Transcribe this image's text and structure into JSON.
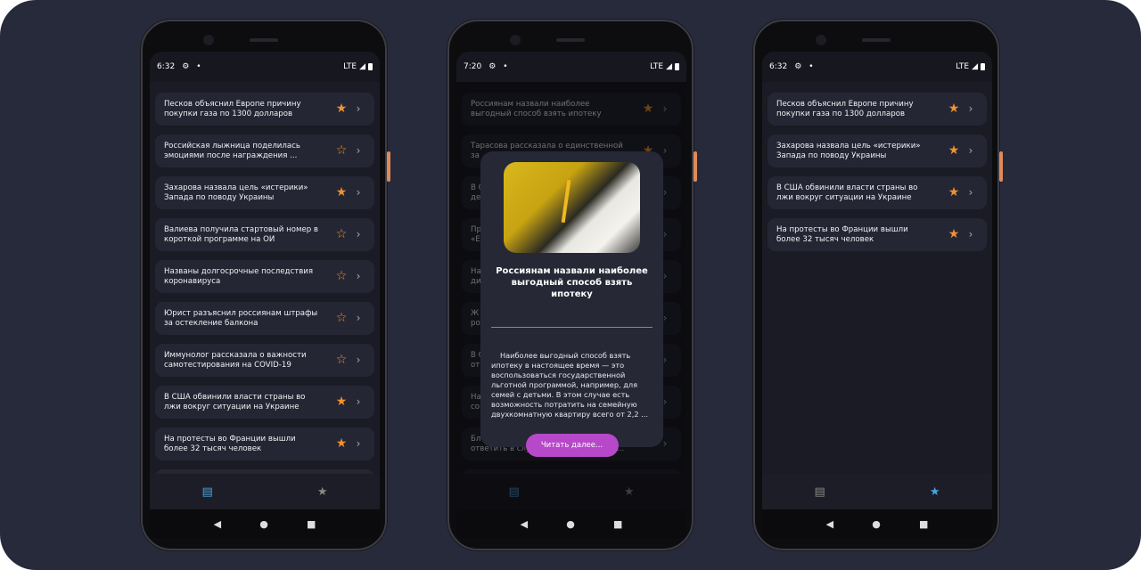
{
  "phones": [
    {
      "time": "6:32",
      "network": "LTE",
      "items": [
        {
          "title": "Песков объяснил Европе причину\nпокупки газа по 1300 долларов",
          "fav": true
        },
        {
          "title": "Российская лыжница поделилась\nэмоциями после награждения ...",
          "fav": false
        },
        {
          "title": "Захарова назвала цель «истерики»\nЗапада по поводу Украины",
          "fav": true
        },
        {
          "title": "Валиева получила стартовый номер в\nкороткой программе на ОИ",
          "fav": false
        },
        {
          "title": "Названы долгосрочные последствия\nкоронавируса",
          "fav": false
        },
        {
          "title": "Юрист разъяснил россиянам штрафы\nза остекление балкона",
          "fav": false
        },
        {
          "title": "Иммунолог рассказала о важности\nсамотестирования на COVID-19",
          "fav": false
        },
        {
          "title": "В США обвинили власти страны во\nлжи вокруг ситуации на Украине",
          "fav": true
        },
        {
          "title": "На протесты во Франции вышли\nболее 32 тысяч человек",
          "fav": true
        },
        {
          "title": "",
          "fav": false
        }
      ],
      "active_tab": "news"
    },
    {
      "time": "7:20",
      "network": "LTE",
      "items": [
        {
          "title": "Россиянам назвали наиболее\nвыгодный способ взять ипотеку",
          "fav": true
        },
        {
          "title": "Тарасова рассказала о единственной\nза",
          "fav": true
        },
        {
          "title": "В С\nде",
          "fav": false
        },
        {
          "title": "Пр\n«Е",
          "fav": false
        },
        {
          "title": "На\nди",
          "fav": false
        },
        {
          "title": "Ж\nро",
          "fav": false
        },
        {
          "title": "В С\nот",
          "fav": false
        },
        {
          "title": "На\nсо",
          "fav": false
        },
        {
          "title": "Бл\nответить в случае агрессии против ...",
          "fav": true
        },
        {
          "title": "",
          "fav": false
        }
      ],
      "active_tab": "news",
      "modal": {
        "title": "Россиянам назвали наиболее выгодный способ взять ипотеку",
        "body": "Наиболее выгодный способ взять ипотеку в настоящее время — это воспользоваться государственной льготной программой, например, для семей с детьми. В этом случае есть возможность потратить на семейную двухкомнатную квартиру всего от 2,2 ...",
        "button": "Читать далее..."
      }
    },
    {
      "time": "6:32",
      "network": "LTE",
      "items": [
        {
          "title": "Песков объяснил Европе причину\nпокупки газа по 1300 долларов",
          "fav": true
        },
        {
          "title": "Захарова назвала цель «истерики»\nЗапада по поводу Украины",
          "fav": true
        },
        {
          "title": "В США обвинили власти страны во\nлжи вокруг ситуации на Украине",
          "fav": true
        },
        {
          "title": "На протесты во Франции вышли\nболее 32 тысяч человек",
          "fav": true
        }
      ],
      "active_tab": "favorites"
    }
  ],
  "colors": {
    "accent": "#4aa3df",
    "star": "#f2922b",
    "button": "#b748c9"
  }
}
